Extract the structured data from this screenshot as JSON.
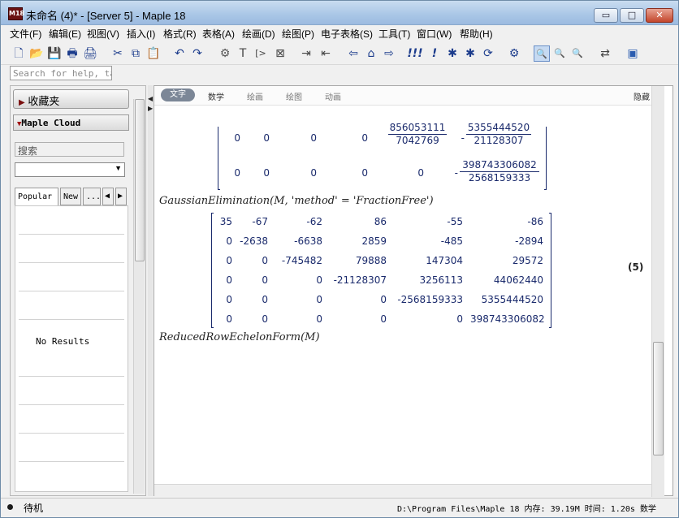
{
  "window": {
    "app_icon_text": "M18",
    "title": "未命名 (4)* - [Server 5] - Maple 18",
    "minimize": "▭",
    "maximize": "□",
    "close": "✕"
  },
  "menu": [
    "文件(F)",
    "编辑(E)",
    "视图(V)",
    "插入(I)",
    "格式(R)",
    "表格(A)",
    "绘画(D)",
    "绘图(P)",
    "电子表格(S)",
    "工具(T)",
    "窗口(W)",
    "帮助(H)"
  ],
  "toolbar": {
    "icons": [
      "new-icon",
      "open-icon",
      "save-icon",
      "print-icon",
      "print-preview-icon",
      "cut-icon",
      "copy-icon",
      "paste-icon",
      "undo-icon",
      "redo-icon",
      "insert-code-icon",
      "text-icon",
      "prompt-icon",
      "section-icon",
      "indent-icon",
      "outdent-icon",
      "back-icon",
      "home-icon",
      "forward-icon",
      "execute-all-icon",
      "execute-icon",
      "debug-icon",
      "restart-icon",
      "settings-icon",
      "zoom-100-icon",
      "zoom-150-icon",
      "zoom-200-icon",
      "toggle-icon",
      "palette-icon"
    ],
    "glyphs": [
      "🗋",
      "📂",
      "💾",
      "🖶",
      "🖨",
      "✂",
      "⧉",
      "📋",
      "↶",
      "↷",
      "⚙",
      "T",
      "[>",
      "⊠",
      "⇥",
      "⇤",
      "⇦",
      "⌂",
      "⇨",
      "!!!",
      "!",
      "✱",
      "⟳",
      "⚙",
      "🔍",
      "🔍",
      "🔍",
      "⇄",
      "▣"
    ]
  },
  "search_placeholder": "Search for help, tas",
  "left_panel": {
    "favorites_label": "收藏夹",
    "cloud_label": "Maple Cloud",
    "search_label": "搜索",
    "tabs": [
      "Popular",
      "New",
      "..."
    ],
    "no_results": "No Results"
  },
  "context_bar": {
    "tabs": [
      "文字",
      "数学",
      "绘画",
      "绘图",
      "动画"
    ],
    "hide_label": "隐藏"
  },
  "document": {
    "cmd1": "GaussianElimination(M, 'method' = 'FractionFree')",
    "cmd2": "ReducedRowEchelonForm(M)",
    "eq_label": "(5)",
    "top_matrix_row1": [
      "0",
      "0",
      "0",
      "0"
    ],
    "top_frac_a": {
      "num": "856053111",
      "den": "7042769"
    },
    "top_frac_b": {
      "sign": "-",
      "num": "5355444520",
      "den": "21128307"
    },
    "top_matrix_row2": [
      "0",
      "0",
      "0",
      "0",
      "0"
    ],
    "top_frac_c": {
      "sign": "-",
      "num": "398743306082",
      "den": "2568159333"
    },
    "matrix": [
      [
        "35",
        "-67",
        "-62",
        "86",
        "-55",
        "-86"
      ],
      [
        "0",
        "-2638",
        "-6638",
        "2859",
        "-485",
        "-2894"
      ],
      [
        "0",
        "0",
        "-745482",
        "79888",
        "147304",
        "29572"
      ],
      [
        "0",
        "0",
        "0",
        "-21128307",
        "3256113",
        "44062440"
      ],
      [
        "0",
        "0",
        "0",
        "0",
        "-2568159333",
        "5355444520"
      ],
      [
        "0",
        "0",
        "0",
        "0",
        "0",
        "398743306082"
      ]
    ]
  },
  "status": {
    "state": "待机",
    "path": "D:\\Program Files\\Maple 18",
    "memory_label": "内存: 39.19M",
    "time_label": "时间: 1.20s",
    "mode": "数学"
  }
}
